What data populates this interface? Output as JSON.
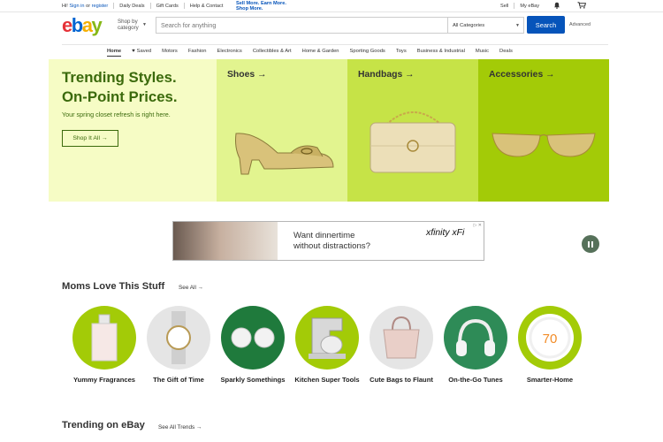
{
  "topbar": {
    "greeting": "Hi!",
    "signin": "Sign in",
    "or": "or",
    "register": "register",
    "daily_deals": "Daily Deals",
    "gift_cards": "Gift Cards",
    "help": "Help & Contact",
    "promo_line1": "Sell More. Earn More.",
    "promo_line2": "Shop More.",
    "sell": "Sell",
    "my_ebay": "My eBay"
  },
  "header": {
    "logo_e": "e",
    "logo_b": "b",
    "logo_a": "a",
    "logo_y": "y",
    "shop_by_line1": "Shop by",
    "shop_by_line2": "category",
    "search_placeholder": "Search for anything",
    "category_select": "All Categories",
    "search_button": "Search",
    "advanced": "Advanced"
  },
  "nav": {
    "items": [
      "Home",
      "Saved",
      "Motors",
      "Fashion",
      "Electronics",
      "Collectibles & Art",
      "Home & Garden",
      "Sporting Goods",
      "Toys",
      "Business & Industrial",
      "Music",
      "Deals"
    ]
  },
  "hero": {
    "title_line1": "Trending Styles.",
    "title_line2": "On-Point Prices.",
    "subtitle": "Your spring closet refresh is right here.",
    "cta": "Shop It All",
    "panels": [
      "Shoes",
      "Handbags",
      "Accessories"
    ]
  },
  "ad": {
    "line1": "Want dinnertime",
    "line2": "without distractions?",
    "brand": "xfinity",
    "brand2": "xFi",
    "choice": "▷ ✕"
  },
  "moms": {
    "title": "Moms Love This Stuff",
    "see_all": "See All",
    "items": [
      {
        "label": "Yummy Fragrances",
        "color": "#a3cb07"
      },
      {
        "label": "The Gift of Time",
        "color": "#e5e5e5"
      },
      {
        "label": "Sparkly Somethings",
        "color": "#1f7a3c"
      },
      {
        "label": "Kitchen Super Tools",
        "color": "#a3cb07"
      },
      {
        "label": "Cute Bags to Flaunt",
        "color": "#e5e5e5"
      },
      {
        "label": "On-the-Go Tunes",
        "color": "#2e8b57"
      },
      {
        "label": "Smarter-Home",
        "color": "#a3cb07"
      }
    ]
  },
  "thermostat_value": "70",
  "trending": {
    "title": "Trending on eBay",
    "see_all": "See All Trends"
  }
}
